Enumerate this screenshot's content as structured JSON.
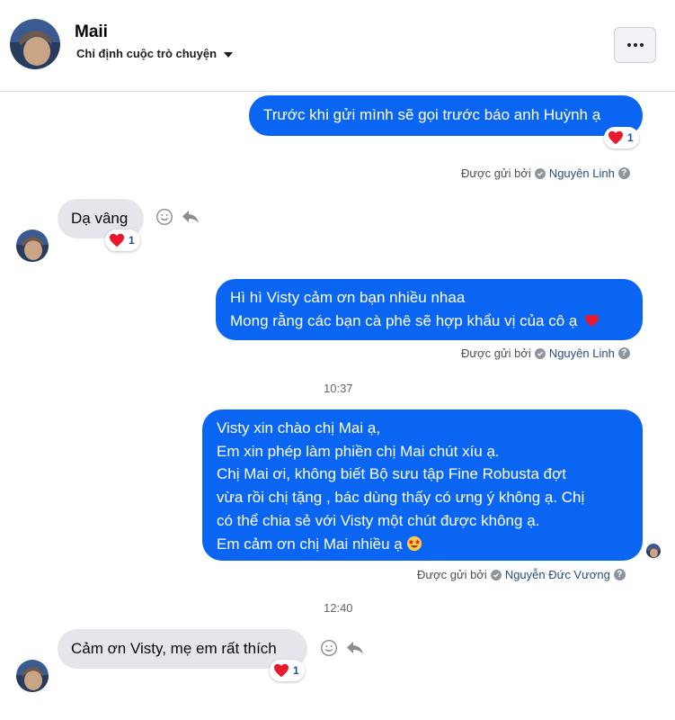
{
  "contact": {
    "name": "Maii",
    "subtitle": "Chỉ định cuộc trò chuyện"
  },
  "messages": [
    {
      "direction": "outgoing",
      "lines": [
        "Trước khi gửi mình sẽ gọi trước báo anh Huỳnh ạ"
      ],
      "reaction_count": "1",
      "sent_by_label": "Được gửi bởi",
      "sent_by_name": "Nguyên Linh"
    },
    {
      "direction": "incoming",
      "lines": [
        "Dạ vâng"
      ],
      "reaction_count": "1"
    },
    {
      "direction": "outgoing",
      "lines": [
        "Hì hì Visty cảm ơn bạn nhiều nhaa",
        "Mong rằng các bạn cà phê sẽ hợp khẩu vị của cô ạ"
      ],
      "sent_by_label": "Được gửi bởi",
      "sent_by_name": "Nguyên Linh"
    },
    {
      "direction": "outgoing",
      "lines": [
        "Visty xin chào chị Mai ạ,",
        "Em xin phép làm phiền chị Mai chút xíu ạ.",
        "Chị Mai ơi, không biết Bộ sưu tập Fine Robusta  đợt",
        "vừa rồi chị tặng , bác dùng thấy có ưng ý không ạ. Chị",
        "có thể chia sẻ với Visty một chút được không ạ.",
        "Em cảm ơn chị Mai nhiều ạ"
      ],
      "sent_by_label": "Được gửi bởi",
      "sent_by_name": "Nguyễn Đức Vương"
    },
    {
      "direction": "incoming",
      "lines": [
        "Cảm ơn Visty, mẹ em rất thích"
      ],
      "reaction_count": "1"
    }
  ],
  "timestamps": [
    "10:37",
    "12:40"
  ],
  "icons": {
    "more": "more-options-icon",
    "emoji": "smiley-icon",
    "reply": "reply-icon",
    "heart": "heart-icon",
    "seen": "seen-avatar-icon"
  },
  "colors": {
    "outgoing_bubble": "#0a66f2",
    "incoming_bubble": "#e4e6eb",
    "heart": "#e8192c"
  }
}
